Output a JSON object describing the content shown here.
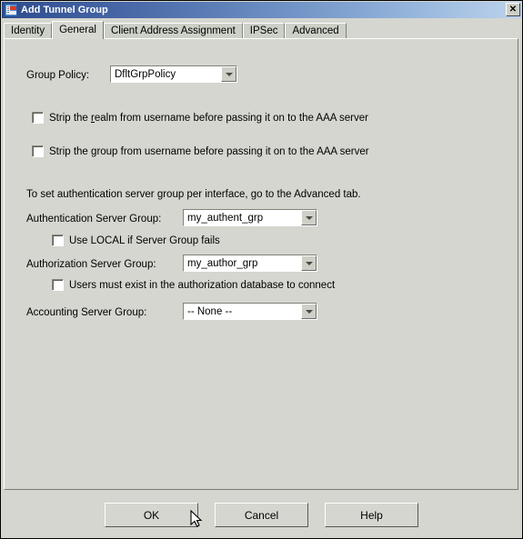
{
  "window": {
    "title": "Add Tunnel Group",
    "icon": "tunnel-group-icon",
    "close_label": "✕"
  },
  "tabs": [
    {
      "label": "Identity",
      "selected": false
    },
    {
      "label": "General",
      "selected": true
    },
    {
      "label": "Client Address Assignment",
      "selected": false
    },
    {
      "label": "IPSec",
      "selected": false
    },
    {
      "label": "Advanced",
      "selected": false
    }
  ],
  "general": {
    "group_policy_label": "Group Policy:",
    "group_policy_value": "DfltGrpPolicy",
    "strip_realm": {
      "checked": false,
      "pre": "Strip the ",
      "mnemonic": "r",
      "post": "ealm from username before passing it on to the AAA server"
    },
    "strip_group": {
      "checked": false,
      "pre": "Strip the ",
      "mnemonic": "g",
      "post": "roup from username before passing it on to the AAA server"
    },
    "advanced_note": "To set authentication server group per interface, go to the Advanced tab.",
    "auth_server_label": "Authentication Server Group:",
    "auth_server_value": "my_authent_grp",
    "use_local_label": "Use LOCAL if Server Group fails",
    "use_local_checked": false,
    "author_server_label": "Authorization Server Group:",
    "author_server_value": "my_author_grp",
    "users_must_exist_label": "Users must exist in the authorization database to connect",
    "users_must_exist_checked": false,
    "acct_server_label": "Accounting Server Group:",
    "acct_server_value": "-- None --"
  },
  "buttons": {
    "ok": "OK",
    "cancel": "Cancel",
    "help": "Help"
  },
  "colors": {
    "dialog_bg": "#d4d6cf",
    "titlebar_start": "#2c4b8c",
    "titlebar_end": "#bcd3ec",
    "field_bg": "#ffffff",
    "text": "#000000"
  }
}
